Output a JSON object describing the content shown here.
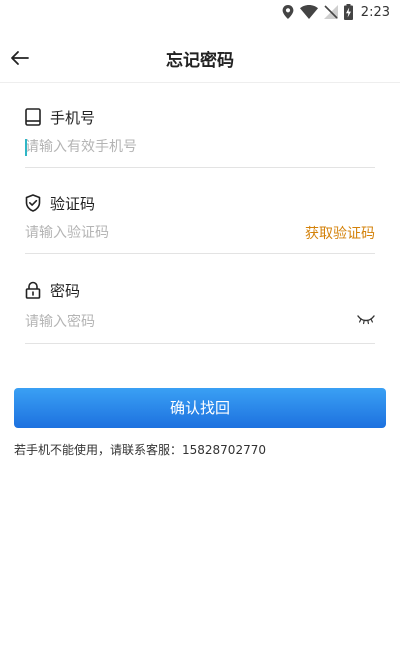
{
  "status_bar": {
    "time": "2:23",
    "icons": [
      "location-icon",
      "wifi-icon",
      "no-signal-icon",
      "battery-charging-icon"
    ]
  },
  "header": {
    "title": "忘记密码",
    "back_icon": "arrow-left-icon"
  },
  "form": {
    "phone": {
      "label": "手机号",
      "icon": "phone-icon",
      "placeholder": "请输入有效手机号",
      "value": ""
    },
    "code": {
      "label": "验证码",
      "icon": "shield-check-icon",
      "placeholder": "请输入验证码",
      "value": "",
      "get_code_label": "获取验证码"
    },
    "password": {
      "label": "密码",
      "icon": "lock-icon",
      "placeholder": "请输入密码",
      "value": "",
      "toggle_icon": "eye-closed-icon"
    }
  },
  "submit": {
    "label": "确认找回"
  },
  "help": {
    "text": "若手机不能使用，请联系客服：15828702770"
  },
  "colors": {
    "accent_orange": "#d4820a",
    "button_top": "#3aa0f4",
    "button_bottom": "#1d71df",
    "caret": "#2fb6c6"
  }
}
